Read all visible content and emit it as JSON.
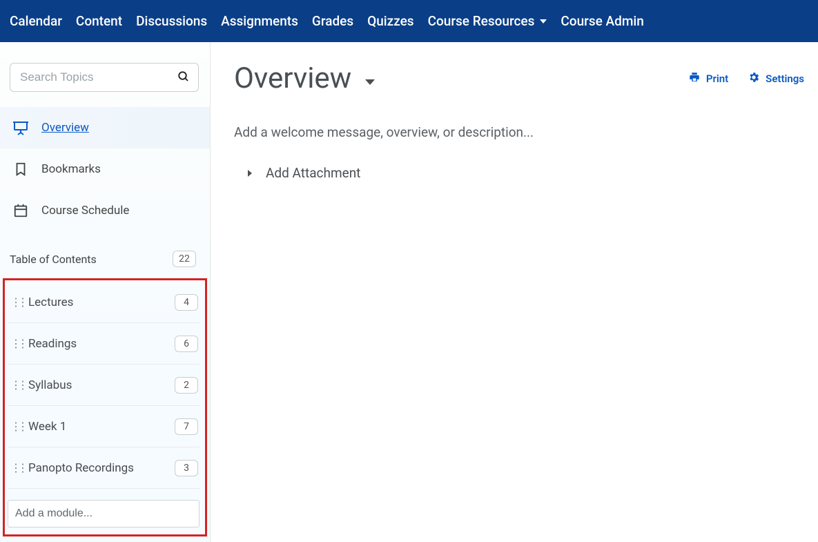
{
  "topnav": {
    "items": [
      {
        "label": "Calendar"
      },
      {
        "label": "Content"
      },
      {
        "label": "Discussions"
      },
      {
        "label": "Assignments"
      },
      {
        "label": "Grades"
      },
      {
        "label": "Quizzes"
      },
      {
        "label": "Course Resources",
        "dropdown": true
      },
      {
        "label": "Course Admin"
      }
    ]
  },
  "sidebar": {
    "search_placeholder": "Search Topics",
    "primary": [
      {
        "label": "Overview",
        "icon": "presentation",
        "active": true
      },
      {
        "label": "Bookmarks",
        "icon": "bookmark"
      },
      {
        "label": "Course Schedule",
        "icon": "calendar"
      }
    ],
    "toc_label": "Table of Contents",
    "toc_count": "22",
    "modules": [
      {
        "label": "Lectures",
        "count": "4"
      },
      {
        "label": "Readings",
        "count": "6"
      },
      {
        "label": "Syllabus",
        "count": "2"
      },
      {
        "label": "Week 1",
        "count": "7"
      },
      {
        "label": "Panopto Recordings",
        "count": "3"
      }
    ],
    "add_module_placeholder": "Add a module..."
  },
  "main": {
    "title": "Overview",
    "print_label": "Print",
    "settings_label": "Settings",
    "welcome_text": "Add a welcome message, overview, or description...",
    "attachment_label": "Add Attachment"
  }
}
